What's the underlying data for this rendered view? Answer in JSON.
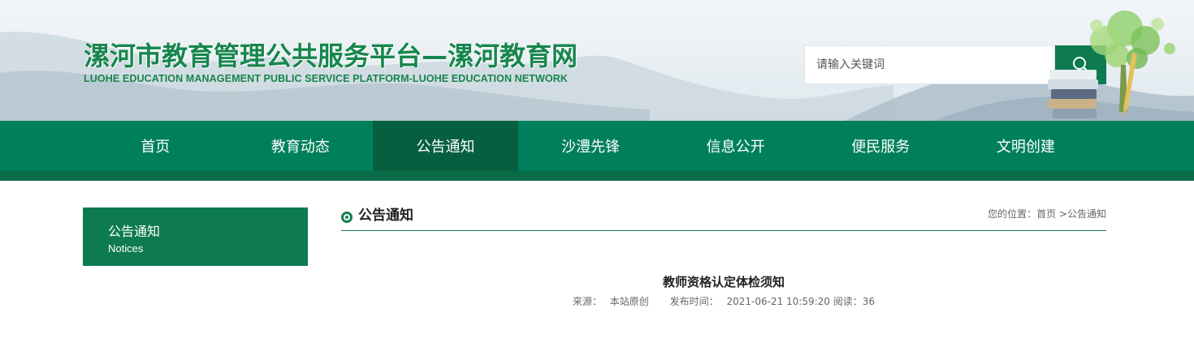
{
  "header": {
    "logo_cn": "漯河市教育管理公共服务平台—漯河教育网",
    "logo_en": "LUOHE EDUCATION MANAGEMENT PUBLIC SERVICE PLATFORM-LUOHE EDUCATION NETWORK",
    "search": {
      "placeholder": "请输入关键词",
      "icon": "search-icon"
    }
  },
  "nav": {
    "items": [
      {
        "label": "首页"
      },
      {
        "label": "教育动态"
      },
      {
        "label": "公告通知",
        "active": true
      },
      {
        "label": "沙澧先锋"
      },
      {
        "label": "信息公开"
      },
      {
        "label": "便民服务"
      },
      {
        "label": "文明创建"
      }
    ]
  },
  "sidebar": {
    "title_cn": "公告通知",
    "title_en": "Notices"
  },
  "content": {
    "section_title": "公告通知",
    "breadcrumb": {
      "prefix": "您的位置：",
      "home": "首页",
      "separator": " >",
      "current": "公告通知"
    },
    "article": {
      "title": "教师资格认定体检须知",
      "source_label": "来源：",
      "source": "本站原创",
      "date_label": "发布时间：",
      "date": "2021-06-21 10:59:20",
      "views_label": "阅读：",
      "views": "36"
    }
  },
  "colors": {
    "brand_green": "#0d7a50",
    "nav_green": "#00805a",
    "nav_active": "#065f3f"
  }
}
